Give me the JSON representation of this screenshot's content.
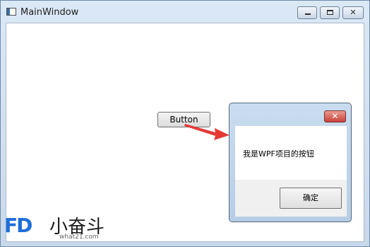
{
  "main_window": {
    "title": "MainWindow",
    "controls": {
      "minimize": "minimize",
      "maximize": "maximize",
      "close": "close"
    }
  },
  "content": {
    "button_label": "Button"
  },
  "message_box": {
    "message": "我是WPF项目的按钮",
    "ok_label": "确定",
    "close_glyph": "✕"
  },
  "watermark": {
    "logo_mark": "FD",
    "brand": "小奋斗",
    "url": "what21.com"
  },
  "colors": {
    "arrow": "#e53935",
    "logo": "#1e6fd9"
  }
}
